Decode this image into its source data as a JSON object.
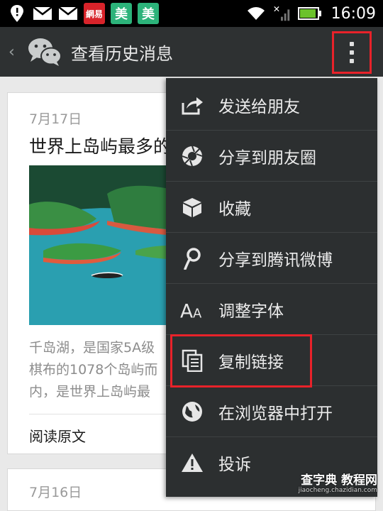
{
  "status_bar": {
    "badges": [
      {
        "text": "網易",
        "color": "#d8232a"
      },
      {
        "text": "美",
        "color": "#2cb37a"
      },
      {
        "text": "美",
        "color": "#2cb37a"
      }
    ],
    "time": "16:09"
  },
  "action_bar": {
    "title": "查看历史消息",
    "icons": {
      "back": "chevron-left-icon",
      "logo": "wechat-logo-icon",
      "more": "overflow-menu-icon"
    }
  },
  "article": {
    "date": "7月17日",
    "title": "世界上岛屿最多的",
    "description_lines": [
      "千岛湖，是国家5A级",
      "棋布的1078个岛屿而",
      "内，是世界上岛屿最"
    ],
    "read_more": "阅读原文"
  },
  "article2": {
    "date": "7月16日"
  },
  "menu": {
    "items": [
      {
        "label": "发送给朋友",
        "icon": "share-forward-icon"
      },
      {
        "label": "分享到朋友圈",
        "icon": "camera-aperture-icon"
      },
      {
        "label": "收藏",
        "icon": "cube-icon"
      },
      {
        "label": "分享到腾讯微博",
        "icon": "tencent-weibo-icon"
      },
      {
        "label": "调整字体",
        "icon": "font-size-icon"
      },
      {
        "label": "复制链接",
        "icon": "copy-icon"
      },
      {
        "label": "在浏览器中打开",
        "icon": "globe-icon"
      },
      {
        "label": "投诉",
        "icon": "warning-icon"
      }
    ],
    "highlighted_index": 5
  },
  "watermark": {
    "main": "查字典 教程网",
    "sub": "jiaocheng.chazidian.com"
  },
  "colors": {
    "highlight": "#e8222a",
    "action_bar": "#2e3132",
    "menu_bg": "#2c2f30"
  }
}
